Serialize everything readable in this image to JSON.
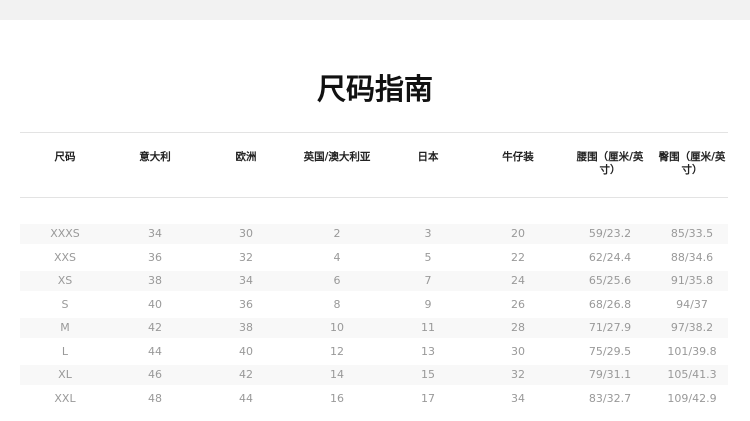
{
  "title": "尺码指南",
  "headers": [
    "尺码",
    "意大利",
    "欧洲",
    "英国/澳大利亚",
    "日本",
    "牛仔装",
    "腰围（厘米/英寸）",
    "臀围（厘米/英寸）"
  ],
  "rows": [
    [
      "XXXS",
      "34",
      "30",
      "2",
      "3",
      "20",
      "59/23.2",
      "85/33.5"
    ],
    [
      "XXS",
      "36",
      "32",
      "4",
      "5",
      "22",
      "62/24.4",
      "88/34.6"
    ],
    [
      "XS",
      "38",
      "34",
      "6",
      "7",
      "24",
      "65/25.6",
      "91/35.8"
    ],
    [
      "S",
      "40",
      "36",
      "8",
      "9",
      "26",
      "68/26.8",
      "94/37"
    ],
    [
      "M",
      "42",
      "38",
      "10",
      "11",
      "28",
      "71/27.9",
      "97/38.2"
    ],
    [
      "L",
      "44",
      "40",
      "12",
      "13",
      "30",
      "75/29.5",
      "101/39.8"
    ],
    [
      "XL",
      "46",
      "42",
      "14",
      "15",
      "32",
      "79/31.1",
      "105/41.3"
    ],
    [
      "XXL",
      "48",
      "44",
      "16",
      "17",
      "34",
      "83/32.7",
      "109/42.9"
    ]
  ]
}
